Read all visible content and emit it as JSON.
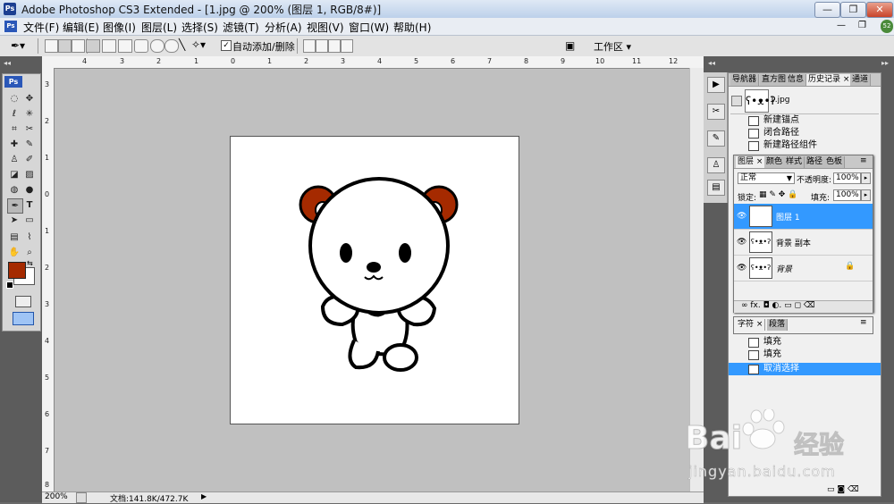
{
  "window": {
    "logo": "Ps",
    "title": "Adobe Photoshop CS3 Extended - [1.jpg @ 200% (图层 1, RGB/8#)]",
    "minimize": "—",
    "restore": "❐",
    "close": "✕"
  },
  "menu": {
    "logo": "Ps",
    "items": [
      "文件(F)",
      "编辑(E)",
      "图像(I)",
      "图层(L)",
      "选择(S)",
      "滤镜(T)",
      "分析(A)",
      "视图(V)",
      "窗口(W)",
      "帮助(H)"
    ]
  },
  "options": {
    "auto_add_delete": "自动添加/删除",
    "workspace": "工作区 ▾"
  },
  "rulers": {
    "top": [
      "4",
      "3",
      "2",
      "1",
      "0",
      "1",
      "2",
      "3",
      "4",
      "5",
      "6",
      "7",
      "8",
      "9",
      "10",
      "11",
      "12"
    ],
    "left": [
      "3",
      "2",
      "1",
      "0",
      "1",
      "2",
      "3",
      "4",
      "5",
      "6",
      "7",
      "8"
    ]
  },
  "toolbox": {
    "logo": "Ps",
    "foreground_color": "#a52a00",
    "background_color": "#ffffff"
  },
  "status": {
    "zoom": "200%",
    "doc": "文档:141.8K/472.7K"
  },
  "history": {
    "tabs": [
      "导航器",
      "直方图",
      "信息",
      "历史记录 ×",
      "通道"
    ],
    "snapshot": "1.jpg",
    "items": [
      "新建锚点",
      "闭合路径",
      "新建路径组件",
      "填充",
      "填充",
      "取消选择"
    ],
    "selected_index": 5
  },
  "layers": {
    "tabs": [
      "图层 ×",
      "颜色",
      "样式",
      "路径",
      "色板"
    ],
    "blend_mode": "正常",
    "opacity_label": "不透明度:",
    "opacity": "100%",
    "lock_label": "锁定:",
    "fill_label": "填充:",
    "fill": "100%",
    "rows": [
      {
        "name": "图层 1",
        "selected": true
      },
      {
        "name": "背景 副本",
        "selected": false
      },
      {
        "name": "背景",
        "selected": false
      }
    ],
    "footer_icons": "∞  fx.  ◘  ◐.  ▭  ◻  ⌫"
  },
  "char_panel": {
    "tabs": [
      "字符 ×",
      "段落"
    ]
  },
  "watermark": {
    "brand": "Bai",
    "brand2": "经验",
    "url": "jingyan.baidu.com"
  },
  "colors": {
    "selection": "#3399ff",
    "bear_ear": "#a52a00",
    "title_gradient_top": "#dfe9f5"
  }
}
